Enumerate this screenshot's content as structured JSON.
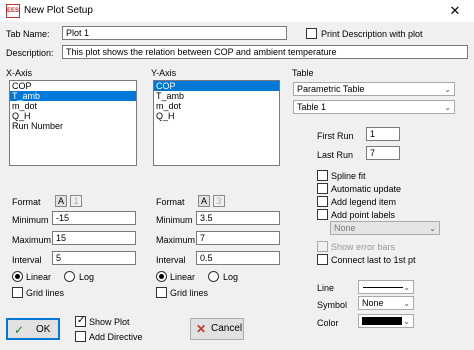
{
  "window": {
    "title": "New Plot Setup",
    "icon_text": "EES",
    "close_glyph": "✕"
  },
  "tab_name": {
    "label": "Tab Name:",
    "value": "Plot 1"
  },
  "print_description": {
    "label": "Print Description with plot",
    "checked": false
  },
  "description": {
    "label": "Description:",
    "value": "This plot shows the relation between COP and ambient temperature"
  },
  "x_axis": {
    "label": "X-Axis",
    "items": [
      "COP",
      "T_amb",
      "m_dot",
      "Q_H",
      "Run Number"
    ],
    "selected": "T_amb",
    "format_label": "Format",
    "format_type": "A",
    "format_digits": "1",
    "minimum_label": "Minimum",
    "minimum": "-15",
    "maximum_label": "Maximum",
    "maximum": "15",
    "interval_label": "Interval",
    "interval": "5",
    "linear_label": "Linear",
    "log_label": "Log",
    "grid_label": "Grid lines"
  },
  "y_axis": {
    "label": "Y-Axis",
    "items": [
      "COP",
      "T_amb",
      "m_dot",
      "Q_H"
    ],
    "selected": "COP",
    "format_label": "Format",
    "format_type": "A",
    "format_digits": "3",
    "minimum_label": "Minimum",
    "minimum": "3.5",
    "maximum_label": "Maximum",
    "maximum": "7",
    "interval_label": "Interval",
    "interval": "0.5",
    "linear_label": "Linear",
    "log_label": "Log",
    "grid_label": "Grid lines"
  },
  "table": {
    "label": "Table",
    "source": "Parametric Table",
    "name": "Table 1"
  },
  "first_run": {
    "label": "First Run",
    "value": "1"
  },
  "last_run": {
    "label": "Last Run",
    "value": "7"
  },
  "options": {
    "spline_fit": "Spline fit",
    "automatic_update": "Automatic update",
    "add_legend_item": "Add legend item",
    "add_point_labels": "Add point labels",
    "point_label_value": "None",
    "show_error_bars": "Show error bars",
    "connect_last": "Connect last to 1st pt"
  },
  "line": {
    "label": "Line"
  },
  "symbol": {
    "label": "Symbol",
    "value": "None"
  },
  "color": {
    "label": "Color",
    "value": "#000000"
  },
  "buttons": {
    "ok": "OK",
    "cancel": "Cancel",
    "show_plot": "Show Plot",
    "add_directive": "Add Directive"
  }
}
